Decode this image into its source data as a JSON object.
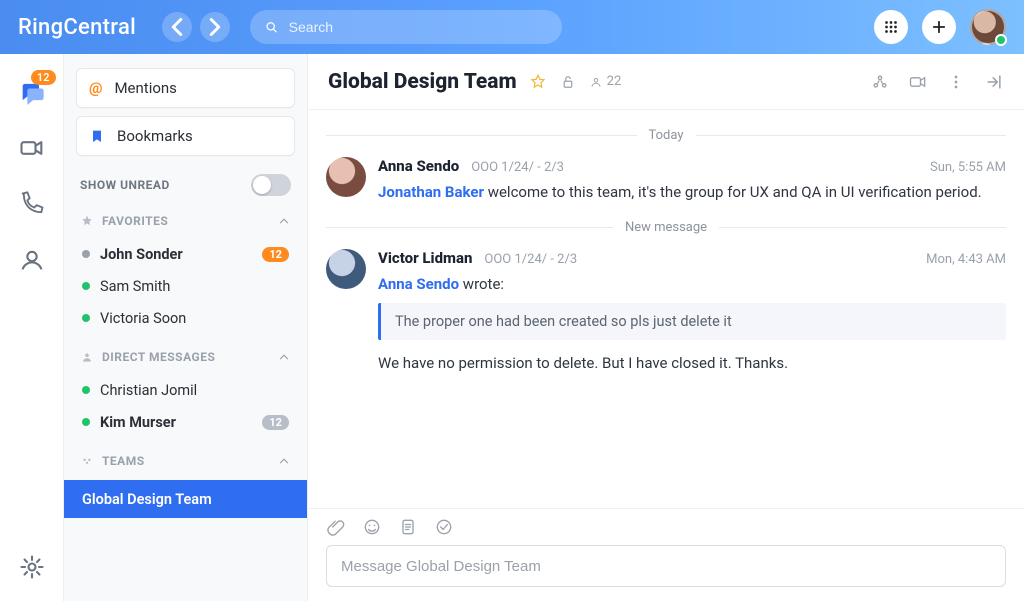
{
  "brand": "RingCentral",
  "search": {
    "placeholder": "Search"
  },
  "rail": {
    "messages_badge": "12"
  },
  "sidebar": {
    "mentions_label": "Mentions",
    "bookmarks_label": "Bookmarks",
    "show_unread_label": "SHOW UNREAD",
    "favorites_label": "FAVORITES",
    "direct_label": "DIRECT MESSAGES",
    "teams_label": "TEAMS",
    "favorites": [
      {
        "name": "John Sonder",
        "presence": "gray",
        "bold": true,
        "badge": "12",
        "badge_color": "orange"
      },
      {
        "name": "Sam Smith",
        "presence": "green"
      },
      {
        "name": "Victoria Soon",
        "presence": "green"
      }
    ],
    "direct": [
      {
        "name": "Christian Jomil",
        "presence": "green"
      },
      {
        "name": "Kim Murser",
        "presence": "green",
        "bold": true,
        "badge": "12",
        "badge_color": "gray"
      }
    ],
    "teams": [
      {
        "name": "Global Design Team",
        "selected": true
      }
    ]
  },
  "chat": {
    "title": "Global Design Team",
    "member_count": "22",
    "today_label": "Today",
    "new_message_label": "New message",
    "messages": [
      {
        "author": "Anna Sendo",
        "status": "OOO 1/24/ - 2/3",
        "time": "Sun, 5:55 AM",
        "mention": "Jonathan Baker",
        "text_after_mention": " welcome to this team, it's the group for UX and QA in UI verification period."
      },
      {
        "author": "Victor Lidman",
        "status": "OOO 1/24/ - 2/3",
        "time": "Mon, 4:43 AM",
        "reply_to": "Anna Sendo",
        "wrote_label": " wrote:",
        "quote": "The proper one had been created so pls just delete it",
        "text": "We have no permission to delete. But I have closed it. Thanks."
      }
    ],
    "composer_placeholder": "Message Global Design Team"
  }
}
